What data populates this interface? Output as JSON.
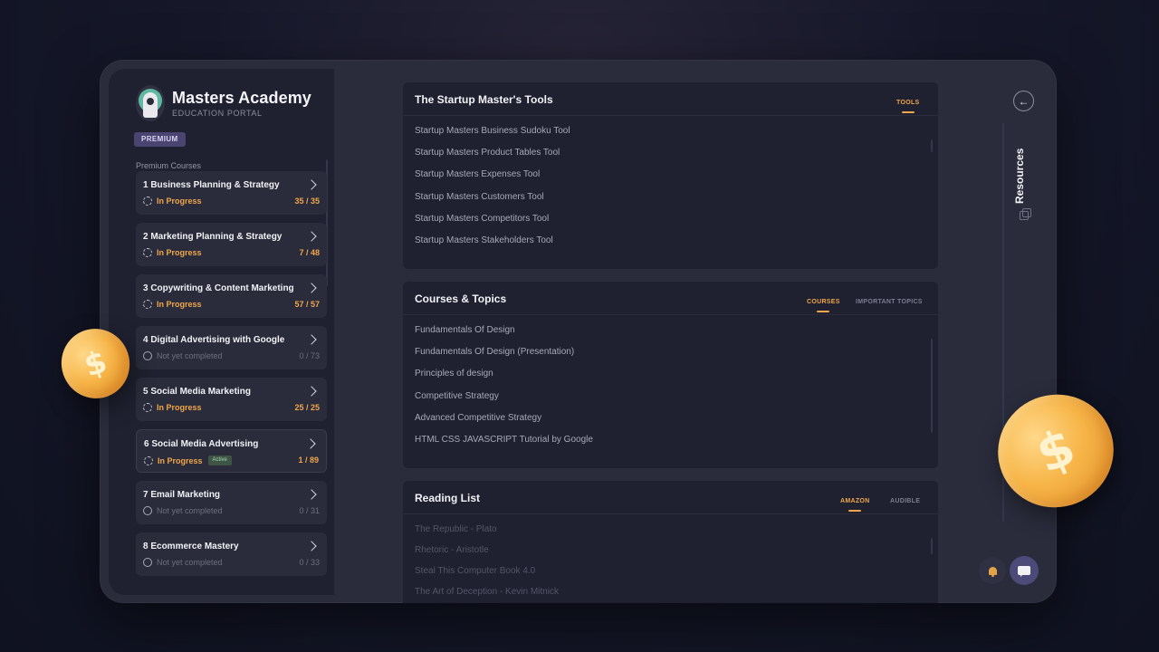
{
  "app": {
    "title": "Masters Academy",
    "subtitle": "EDUCATION PORTAL",
    "badge": "PREMIUM"
  },
  "sidebar": {
    "section_label": "Premium Courses",
    "courses": [
      {
        "title": "1  Business Planning & Strategy",
        "status": "In Progress",
        "count": "35 / 35"
      },
      {
        "title": "2  Marketing Planning & Strategy",
        "status": "In Progress",
        "count": "7 / 48"
      },
      {
        "title": "3  Copywriting & Content Marketing",
        "status": "In Progress",
        "count": "57 / 57"
      },
      {
        "title": "4  Digital Advertising with Google",
        "status": "Not yet completed",
        "count": "0 / 73"
      },
      {
        "title": "5  Social Media Marketing",
        "status": "In Progress",
        "count": "25 / 25"
      },
      {
        "title": "6  Social Media Advertising",
        "status": "In Progress",
        "count": "1 / 89",
        "badge": "Active"
      },
      {
        "title": "7  Email Marketing",
        "status": "Not yet completed",
        "count": "0 / 31"
      },
      {
        "title": "8  Ecommerce Mastery",
        "status": "Not yet completed",
        "count": "0 / 33"
      }
    ]
  },
  "panels": {
    "tools": {
      "title": "The Startup Master's Tools",
      "tabs": [
        "TOOLS"
      ],
      "items": [
        "Startup Masters Business Sudoku Tool",
        "Startup Masters Product Tables Tool",
        "Startup Masters Expenses Tool",
        "Startup Masters Customers Tool",
        "Startup Masters Competitors Tool",
        "Startup Masters Stakeholders Tool"
      ]
    },
    "courses": {
      "title": "Courses & Topics",
      "tabs": [
        "COURSES",
        "IMPORTANT TOPICS"
      ],
      "items": [
        "Fundamentals Of Design",
        "Fundamentals Of Design (Presentation)",
        "Principles of design",
        "Competitive Strategy",
        "Advanced Competitive Strategy",
        "HTML CSS JAVASCRIPT Tutorial by Google"
      ]
    },
    "reading": {
      "title": "Reading List",
      "tabs": [
        "AMAZON",
        "AUDIBLE"
      ],
      "items": [
        "The Republic - Plato",
        "Rhetoric - Aristotle",
        "Steal This Computer Book 4.0",
        "The Art of Deception - Kevin Mitnick"
      ]
    }
  },
  "right_rail": {
    "label": "Resources",
    "back_icon": "←"
  },
  "decor": {
    "coin_symbol": "$"
  },
  "colors": {
    "accent": "#f0a64b",
    "background": "#16182a",
    "panel": "#1f2130",
    "premium": "#4c4470"
  }
}
